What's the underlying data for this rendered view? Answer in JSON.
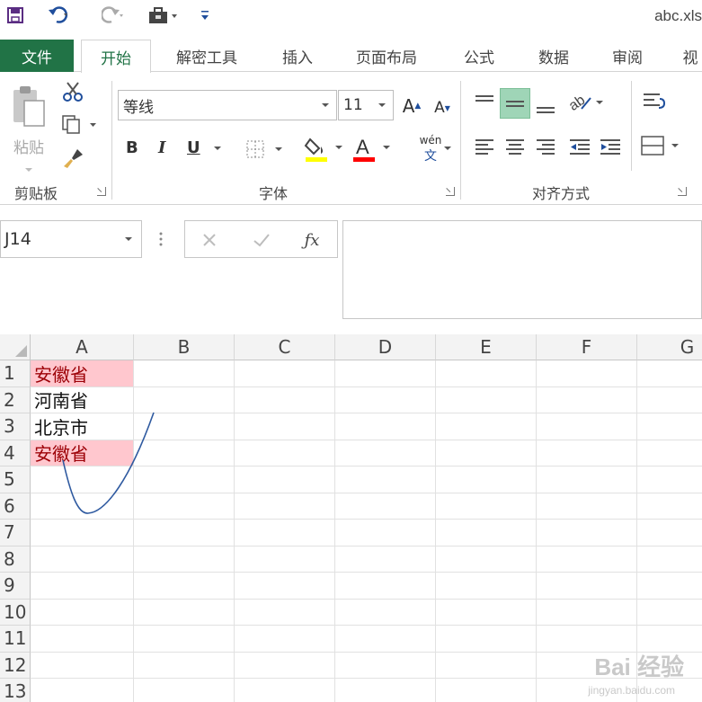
{
  "title": "abc.xls",
  "tabs": [
    {
      "label": "文件"
    },
    {
      "label": "开始"
    },
    {
      "label": "解密工具"
    },
    {
      "label": "插入"
    },
    {
      "label": "页面布局"
    },
    {
      "label": "公式"
    },
    {
      "label": "数据"
    },
    {
      "label": "审阅"
    },
    {
      "label": "视"
    }
  ],
  "ribbon": {
    "clipboard": {
      "paste_label": "粘贴",
      "group_label": "剪贴板"
    },
    "font": {
      "font_name": "等线",
      "font_size": "11",
      "bold": "B",
      "italic": "I",
      "underline": "U",
      "pinyin_top": "wén",
      "pinyin_bottom": "文",
      "group_label": "字体",
      "fill_color": "#ffff00",
      "font_color": "#ff0000",
      "grow_font": "A",
      "shrink_font": "A",
      "font_color_glyph": "A"
    },
    "alignment": {
      "group_label": "对齐方式",
      "active_color": "#9fd5b7"
    }
  },
  "formula_bar": {
    "name_box": "J14",
    "formula": ""
  },
  "grid": {
    "columns": [
      "A",
      "B",
      "C",
      "D",
      "E",
      "F",
      "G"
    ],
    "rows": [
      "1",
      "2",
      "3",
      "4",
      "5",
      "6",
      "7",
      "8",
      "9",
      "10",
      "11",
      "12",
      "13"
    ],
    "cells": {
      "A1": "安徽省",
      "A2": "河南省",
      "A3": "北京市",
      "A4": "安徽省"
    },
    "highlight_bg": "#ffc7ce",
    "highlight_fg": "#9c0006"
  },
  "watermark": {
    "main": "Bai 经验",
    "sub": "jingyan.baidu.com"
  },
  "colors": {
    "accent": "#217346",
    "annotation": "#2f5aa0"
  }
}
